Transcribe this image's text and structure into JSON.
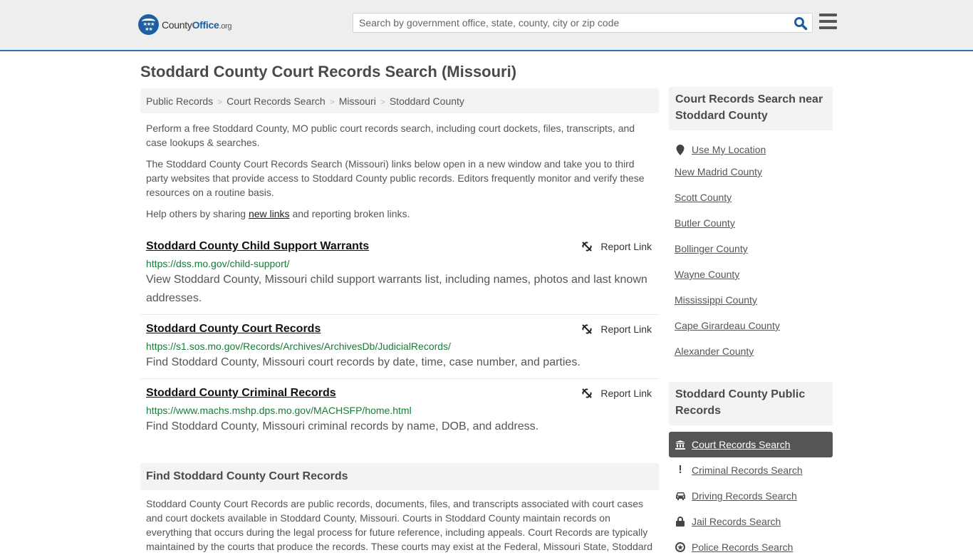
{
  "header": {
    "logo": {
      "county": "County",
      "office": "Office",
      "org": ".org"
    },
    "search_placeholder": "Search by government office, state, county, city or zip code"
  },
  "page_title": "Stoddard County Court Records Search (Missouri)",
  "breadcrumb": [
    "Public Records",
    "Court Records Search",
    "Missouri",
    "Stoddard County"
  ],
  "intro": {
    "p1": "Perform a free Stoddard County, MO public court records search, including court dockets, files, transcripts, and case lookups & searches.",
    "p2": "The Stoddard County Court Records Search (Missouri) links below open in a new window and take you to third party websites that provide access to Stoddard County public records. Editors frequently monitor and verify these resources on a routine basis.",
    "p3_before": "Help others by sharing ",
    "p3_link": "new links",
    "p3_after": " and reporting broken links."
  },
  "links": [
    {
      "title": "Stoddard County Child Support Warrants",
      "url": "https://dss.mo.gov/child-support/",
      "description": "View Stoddard County, Missouri child support warrants list, including names, photos and last known addresses.",
      "report": "Report Link"
    },
    {
      "title": "Stoddard County Court Records",
      "url": "https://s1.sos.mo.gov/Records/Archives/ArchivesDb/JudicialRecords/",
      "description": "Find Stoddard County, Missouri court records by date, time, case number, and parties.",
      "report": "Report Link"
    },
    {
      "title": "Stoddard County Criminal Records",
      "url": "https://www.machs.mshp.dps.mo.gov/MACHSFP/home.html",
      "description": "Find Stoddard County, Missouri criminal records by name, DOB, and address.",
      "report": "Report Link"
    }
  ],
  "find_section": {
    "heading": "Find Stoddard County Court Records",
    "text": "Stoddard County Court Records are public records, documents, files, and transcripts associated with court cases and court dockets available in Stoddard County, Missouri. Courts in Stoddard County maintain records on everything that occurs during the legal process for future reference, including appeals. Court Records are typically maintained by the courts that produce the records. These courts may exist at the Federal, Missouri State, Stoddard"
  },
  "sidebar_nearby": {
    "heading": "Court Records Search near Stoddard County",
    "use_location": "Use My Location",
    "counties": [
      "New Madrid County",
      "Scott County",
      "Butler County",
      "Bollinger County",
      "Wayne County",
      "Mississippi County",
      "Cape Girardeau County",
      "Alexander County"
    ]
  },
  "sidebar_records": {
    "heading": "Stoddard County Public Records",
    "items": [
      {
        "label": "Court Records Search",
        "icon": "courthouse-icon",
        "active": true
      },
      {
        "label": "Criminal Records Search",
        "icon": "exclamation-icon"
      },
      {
        "label": "Driving Records Search",
        "icon": "car-icon"
      },
      {
        "label": "Jail Records Search",
        "icon": "lock-icon"
      },
      {
        "label": "Police Records Search",
        "icon": "police-badge-icon"
      }
    ]
  },
  "colors": {
    "brand_blue": "#1d5fa0",
    "header_border": "#3273ad",
    "url_green": "#1b7a3a",
    "active_item_bg": "#555555"
  }
}
